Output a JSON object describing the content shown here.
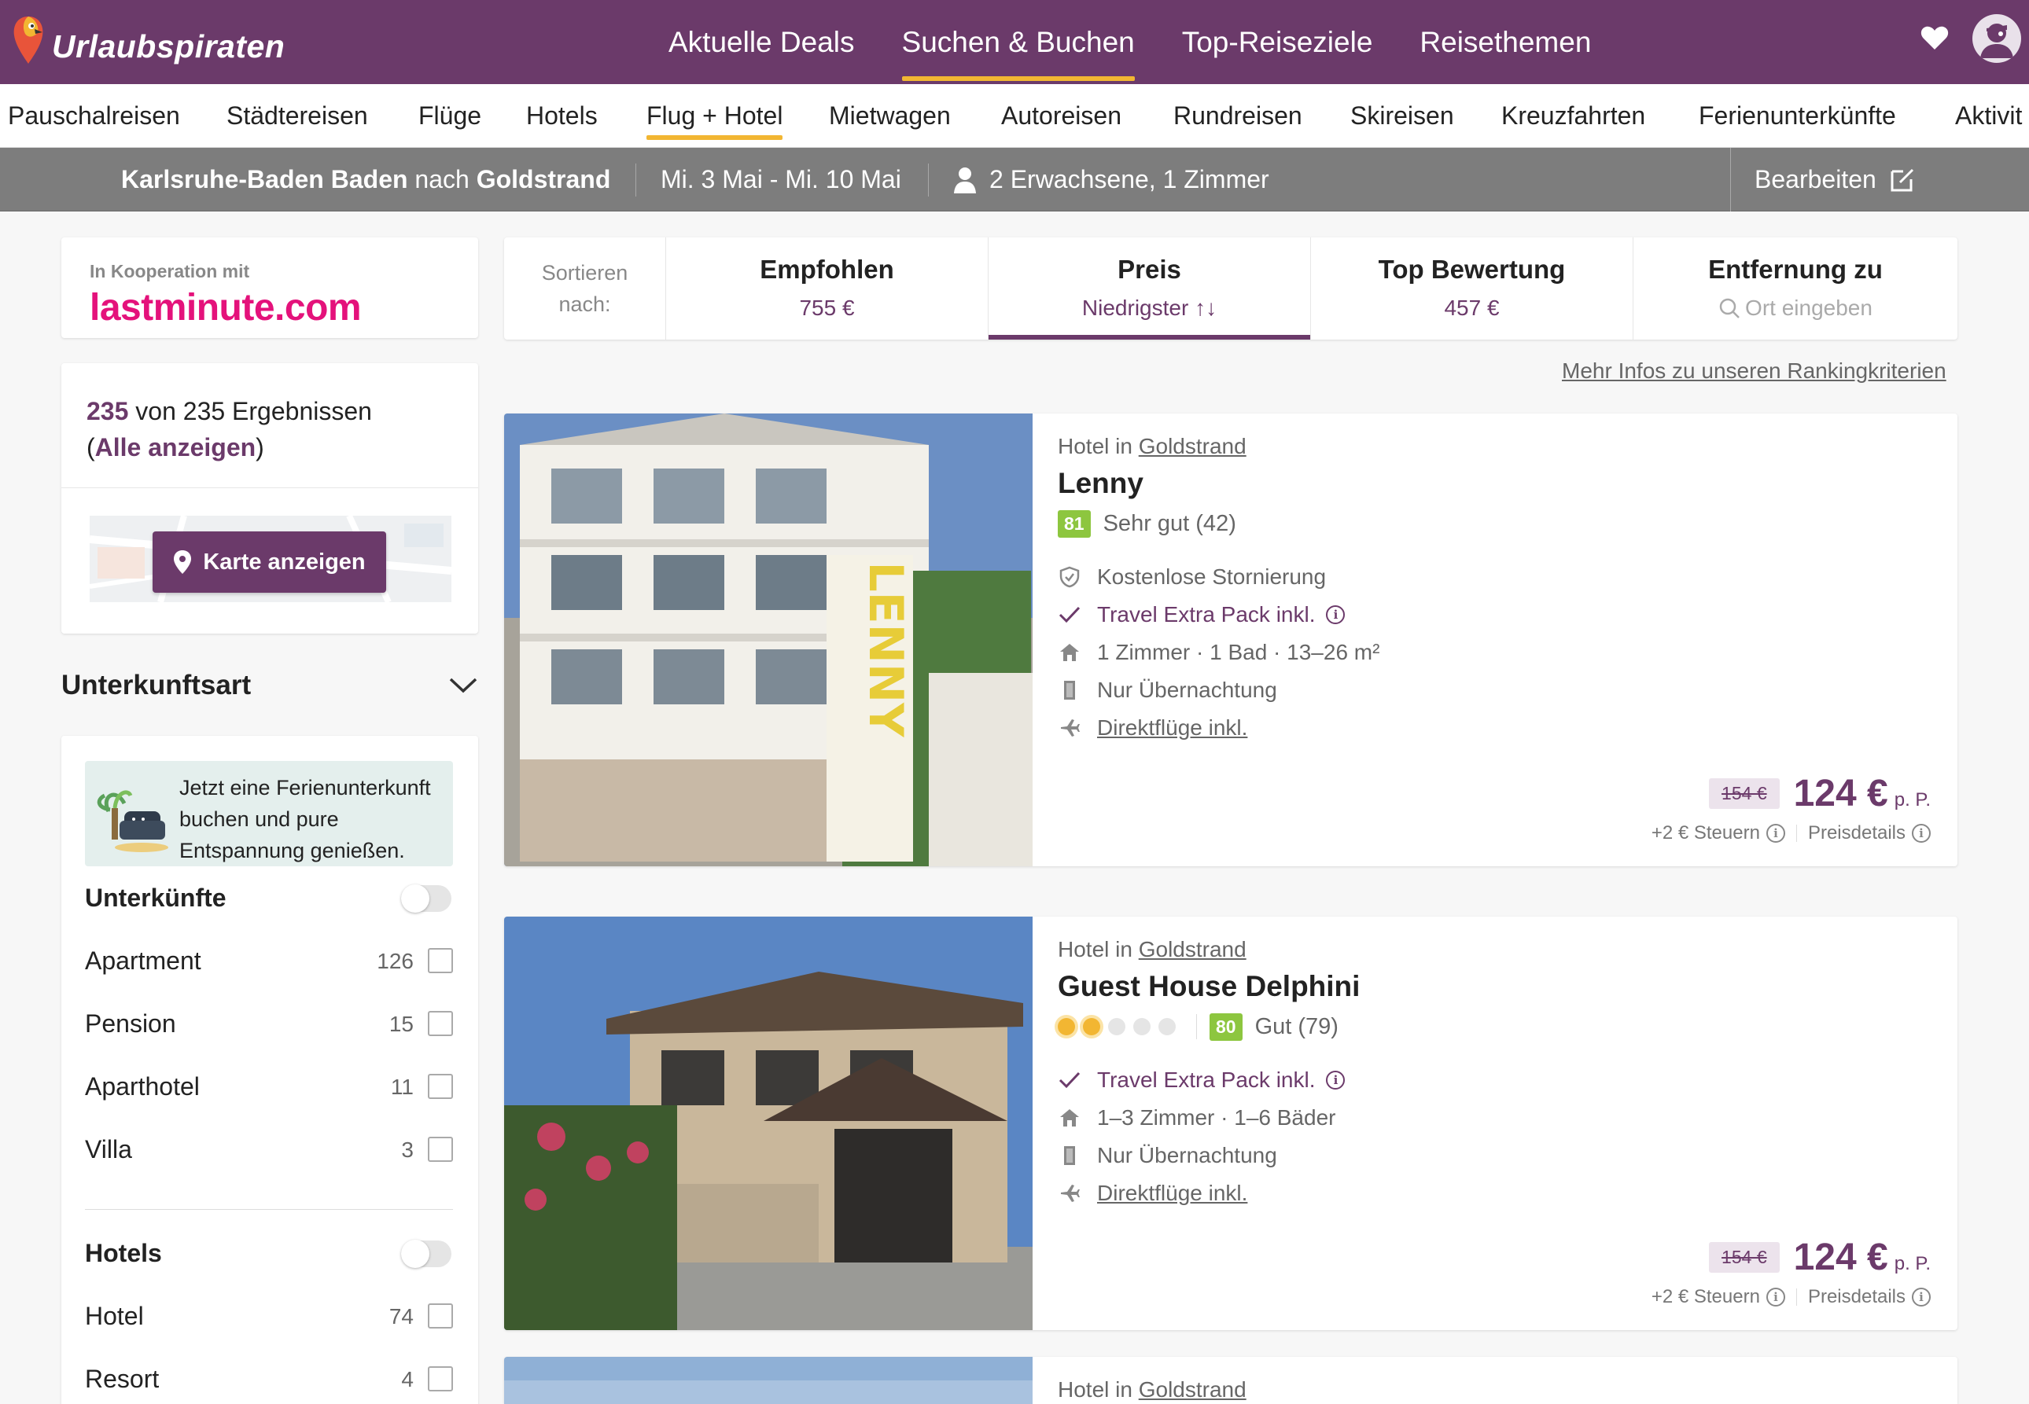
{
  "header": {
    "brand": "Urlaubspiraten",
    "nav": [
      {
        "label": "Aktuelle Deals",
        "active": false
      },
      {
        "label": "Suchen & Buchen",
        "active": true
      },
      {
        "label": "Top-Reiseziele",
        "active": false
      },
      {
        "label": "Reisethemen",
        "active": false
      }
    ],
    "accent": "#6b3a6a",
    "highlight": "#f2b632"
  },
  "categories": [
    {
      "label": "Pauschalreisen",
      "active": false
    },
    {
      "label": "Städtereisen",
      "active": false
    },
    {
      "label": "Flüge",
      "active": false
    },
    {
      "label": "Hotels",
      "active": false
    },
    {
      "label": "Flug + Hotel",
      "active": true
    },
    {
      "label": "Mietwagen",
      "active": false
    },
    {
      "label": "Autoreisen",
      "active": false
    },
    {
      "label": "Rundreisen",
      "active": false
    },
    {
      "label": "Skireisen",
      "active": false
    },
    {
      "label": "Kreuzfahrten",
      "active": false
    },
    {
      "label": "Ferienunterkünfte",
      "active": false
    },
    {
      "label": "Aktivit",
      "active": false
    }
  ],
  "search": {
    "origin": "Karlsruhe-Baden Baden",
    "connector": "nach",
    "destination": "Goldstrand",
    "dates": "Mi. 3 Mai - Mi. 10 Mai",
    "travellers": "2 Erwachsene, 1 Zimmer",
    "edit_label": "Bearbeiten"
  },
  "cooperation": {
    "label": "In Kooperation mit",
    "partner": "lastminute.com"
  },
  "results": {
    "shown": "235",
    "text_middle": "von 235 Ergebnissen",
    "paren_open": "(",
    "show_all": "Alle anzeigen",
    "paren_close": ")",
    "map_button": "Karte anzeigen"
  },
  "filters": {
    "section_title": "Unterkunftsart",
    "promo_text": "Jetzt eine Ferienunterkunft buchen und pure Entspannung genießen.",
    "groups": [
      {
        "title": "Unterkünfte",
        "items": [
          {
            "label": "Apartment",
            "count": "126"
          },
          {
            "label": "Pension",
            "count": "15"
          },
          {
            "label": "Aparthotel",
            "count": "11"
          },
          {
            "label": "Villa",
            "count": "3"
          }
        ]
      },
      {
        "title": "Hotels",
        "items": [
          {
            "label": "Hotel",
            "count": "74"
          },
          {
            "label": "Resort",
            "count": "4"
          }
        ]
      }
    ]
  },
  "sort": {
    "label": "Sortieren nach:",
    "options": [
      {
        "title": "Empfohlen",
        "value": "755 €",
        "active": false
      },
      {
        "title": "Preis",
        "value": "Niedrigster ↑↓",
        "active": true
      },
      {
        "title": "Top Bewertung",
        "value": "457 €",
        "active": false
      },
      {
        "title": "Entfernung zu",
        "value": "Ort eingeben",
        "active": false
      }
    ],
    "ranking_link": "Mehr Infos zu unseren Rankingkriterien"
  },
  "hotels": [
    {
      "type_prefix": "Hotel in",
      "location": "Goldstrand",
      "name": "Lenny",
      "stars": 0,
      "score": "81",
      "rating_text": "Sehr gut (42)",
      "features": [
        {
          "icon": "shield-check-icon",
          "text": "Kostenlose Stornierung"
        },
        {
          "icon": "checkmark-icon",
          "text": "Travel Extra Pack inkl."
        },
        {
          "icon": "house-icon",
          "text": "1 Zimmer · 1 Bad · 13–26 m²"
        },
        {
          "icon": "door-icon",
          "text": "Nur Übernachtung"
        },
        {
          "icon": "plane-icon",
          "text": "Direktflüge inkl."
        }
      ],
      "old_price": "154 €",
      "price": "124 €",
      "per_person": "p. P.",
      "taxes": "+2 € Steuern",
      "price_details": "Preisdetails"
    },
    {
      "type_prefix": "Hotel in",
      "location": "Goldstrand",
      "name": "Guest House Delphini",
      "stars": 2,
      "score": "80",
      "rating_text": "Gut (79)",
      "features": [
        {
          "icon": "checkmark-icon",
          "text": "Travel Extra Pack inkl."
        },
        {
          "icon": "house-icon",
          "text": "1–3 Zimmer · 1–6 Bäder"
        },
        {
          "icon": "door-icon",
          "text": "Nur Übernachtung"
        },
        {
          "icon": "plane-icon",
          "text": "Direktflüge inkl."
        }
      ],
      "old_price": "154 €",
      "price": "124 €",
      "per_person": "p. P.",
      "taxes": "+2 € Steuern",
      "price_details": "Preisdetails"
    },
    {
      "type_prefix": "Hotel in",
      "location": "Goldstrand"
    }
  ]
}
